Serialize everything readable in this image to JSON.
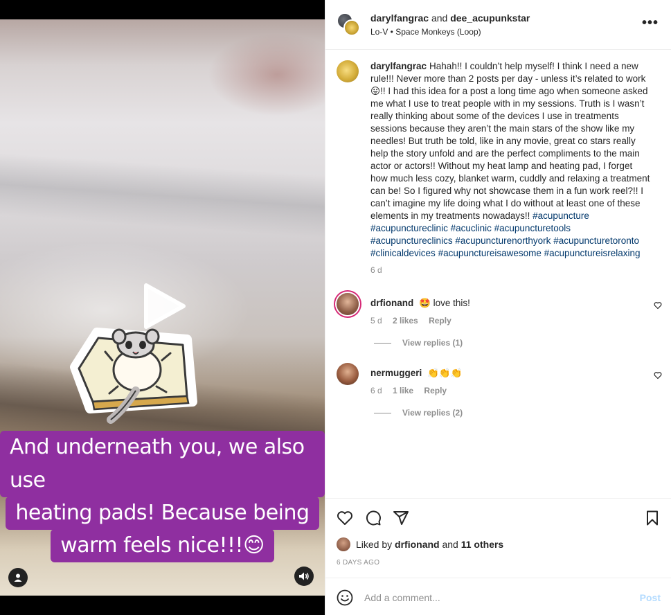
{
  "video": {
    "caption_lines": [
      "And underneath you, we also use",
      "heating pads! Because being",
      "warm feels nice!!!😊"
    ],
    "icons": {
      "play": "play-icon",
      "user_tag": "user-icon",
      "audio": "speaker-icon",
      "sticker": "sugar-glider-sticker"
    }
  },
  "header": {
    "user1": "darylfangrac",
    "and": "and",
    "user2": "dee_acupunkstar",
    "audio": "Lo-V • Space Monkeys (Loop)",
    "more": "•••"
  },
  "caption": {
    "user": "darylfangrac",
    "text_part1": "Hahah!! I couldn’t help myself! I think I need a new rule!!! Never more than 2 posts per day - unless it’s related to work 😛!! I had this idea for a post a long time ago when someone asked me what I use to treat people with in my sessions. Truth is I wasn’t really thinking about some of the devices I use in treatments sessions because they aren’t the main stars of the show like my needles! But truth be told, like in any movie, great co stars really help the story unfold and are the perfect compliments to the main actor or actors!! Without my heat lamp and heating pad, I forget how much less cozy, blanket warm, cuddly and relaxing a treatment can be! So I figured why not showcase them in a fun work reel?!! I can’t imagine my life doing what I do without at least one of these elements in my treatments nowadays!! ",
    "hashtags": [
      "#acupuncture",
      "#acupunctureclinic",
      "#acuclinic",
      "#acupuncturetools",
      "#acupunctureclinics",
      "#acupuncturenorthyork",
      "#acupuncturetoronto",
      "#clinicaldevices",
      "#acupunctureisawesome",
      "#acupunctureisrelaxing"
    ],
    "time": "6 d"
  },
  "comments": [
    {
      "user": "drfionand",
      "text": "🤩 love this!",
      "time": "5 d",
      "likes": "2 likes",
      "reply": "Reply",
      "view_replies": "View replies (1)"
    },
    {
      "user": "nermuggeri",
      "text": "👏👏👏",
      "time": "6 d",
      "likes": "1 like",
      "reply": "Reply",
      "view_replies": "View replies (2)"
    }
  ],
  "actions": {
    "liked_prefix": "Liked by",
    "liked_user": "drfionand",
    "liked_and": "and",
    "liked_others": "11 others",
    "date": "6 DAYS AGO"
  },
  "add_comment": {
    "placeholder": "Add a comment...",
    "post_label": "Post"
  },
  "colors": {
    "caption_bg": "#8f2fa0",
    "link": "#00376b",
    "muted": "#8e8e8e",
    "post_disabled": "#b3dbff"
  }
}
